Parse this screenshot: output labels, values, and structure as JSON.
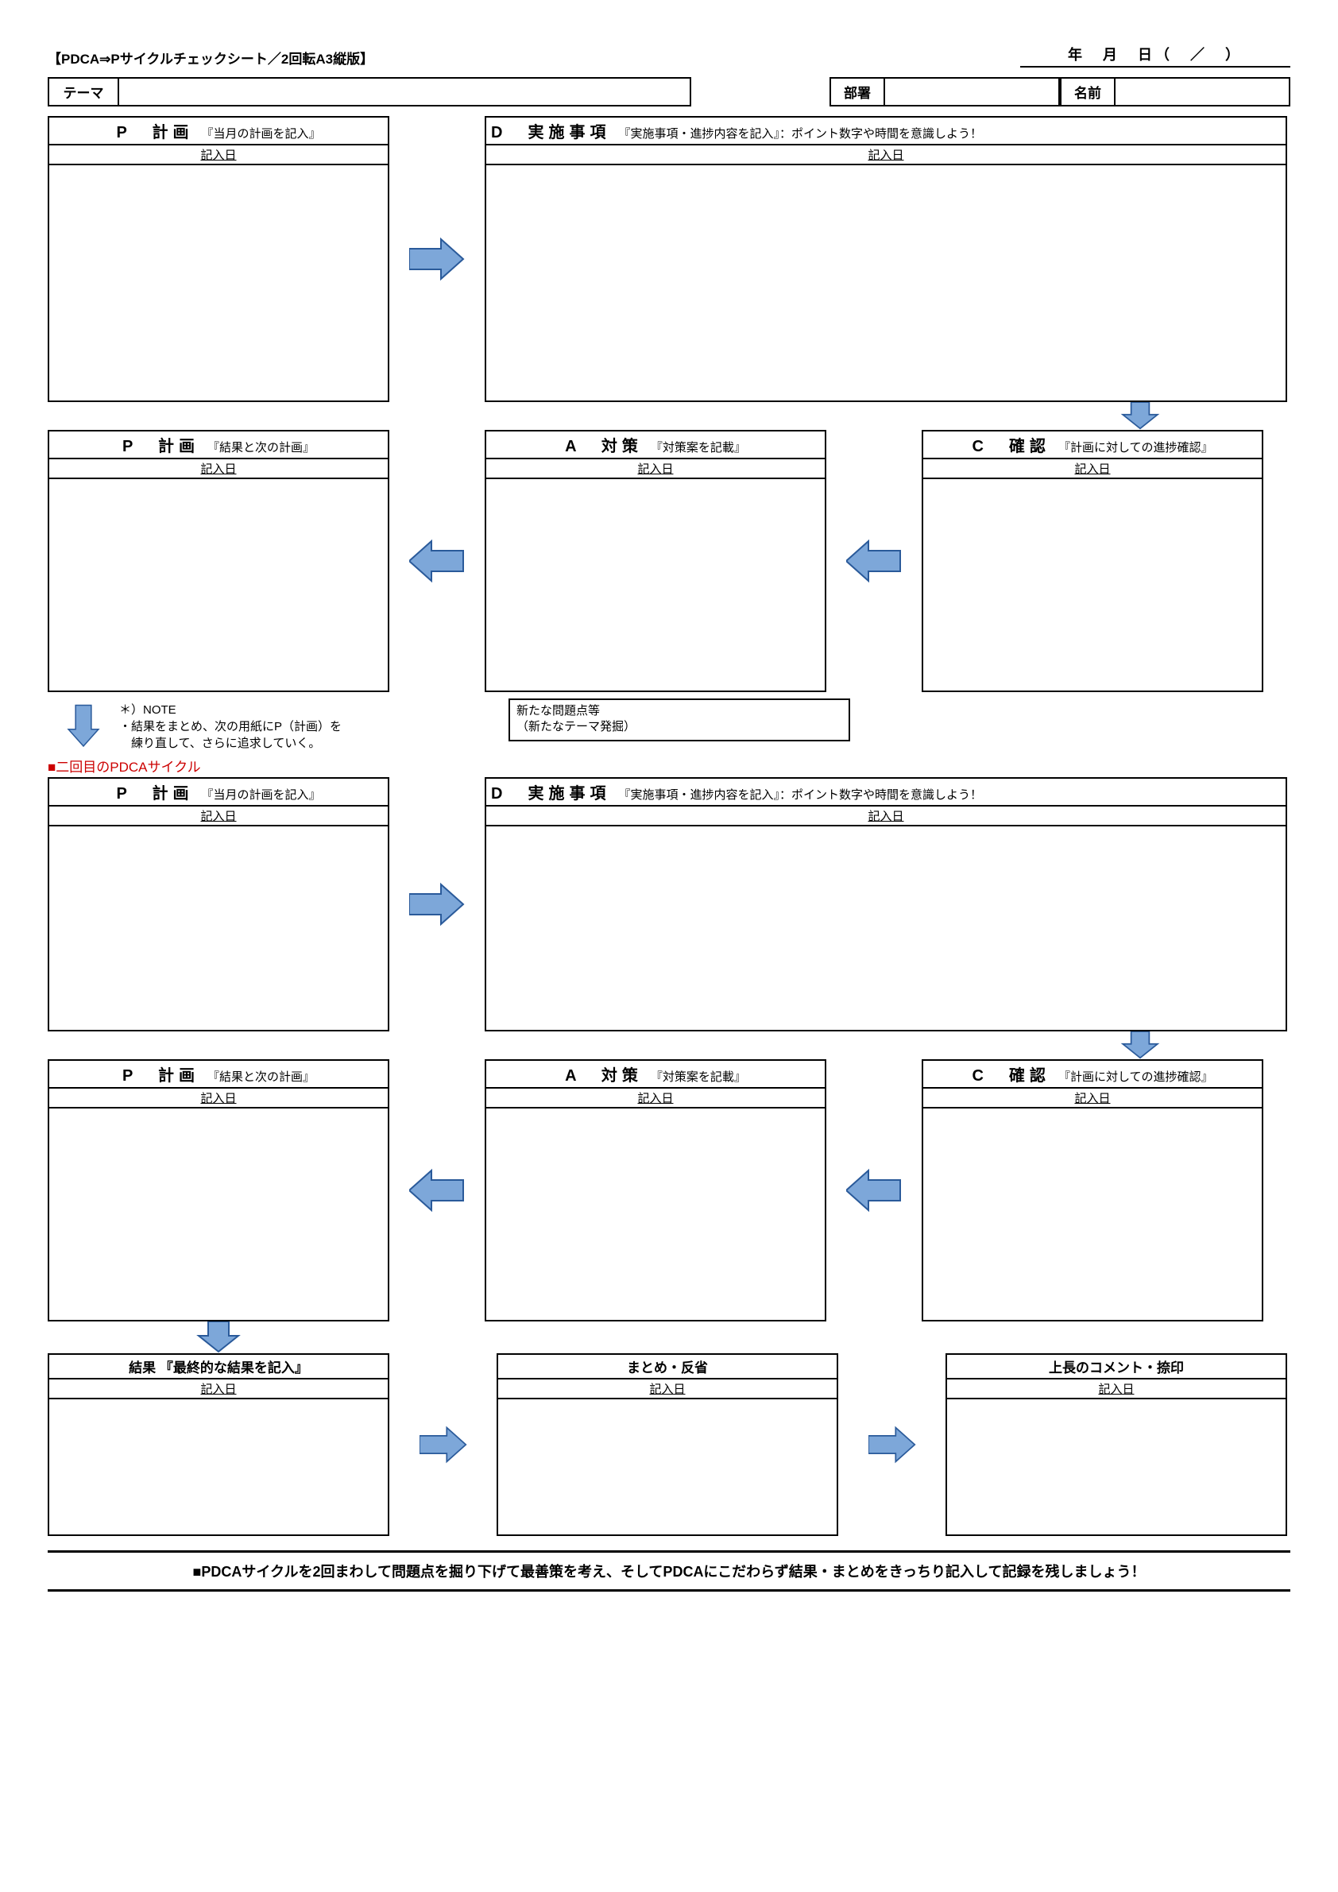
{
  "header": {
    "doc_title": "【PDCA⇒Pサイクルチェックシート／2回転A3縦版】",
    "date_line": "年　月　日（　／　）"
  },
  "meta": {
    "theme_label": "テーマ",
    "dept_label": "部署",
    "name_label": "名前"
  },
  "entry_label": "記入日",
  "cycle1": {
    "p": {
      "code": "P　計画",
      "desc": "『当月の計画を記入』"
    },
    "d": {
      "code": "D　実施事項",
      "desc": "『実施事項・進捗内容を記入』：ポイント数字や時間を意識しよう！"
    },
    "p2": {
      "code": "P　計画",
      "desc": "『結果と次の計画』"
    },
    "a": {
      "code": "A　対策",
      "desc": "『対策案を記載』"
    },
    "c": {
      "code": "C　確認",
      "desc": "『計画に対しての進捗確認』"
    }
  },
  "note": {
    "title": "＊）NOTE",
    "line1": "・結果をまとめ、次の用紙にP（計画）を",
    "line2": "　練り直して、さらに追求していく。"
  },
  "new_issue": {
    "line1": "新たな問題点等",
    "line2": "（新たなテーマ発掘）"
  },
  "red_label": "■二回目のPDCAサイクル",
  "cycle2": {
    "p": {
      "code": "P　計画",
      "desc": "『当月の計画を記入』"
    },
    "d": {
      "code": "D　実施事項",
      "desc": "『実施事項・進捗内容を記入』：ポイント数字や時間を意識しよう！"
    },
    "p2": {
      "code": "P　計画",
      "desc": "『結果と次の計画』"
    },
    "a": {
      "code": "A　対策",
      "desc": "『対策案を記載』"
    },
    "c": {
      "code": "C　確認",
      "desc": "『計画に対しての進捗確認』"
    }
  },
  "final": {
    "result": "結果 『最終的な結果を記入』",
    "summary": "まとめ・反省",
    "boss": "上長のコメント・捺印"
  },
  "bottom_bar": "■PDCAサイクルを2回まわして問題点を掘り下げて最善策を考え、そしてPDCAにこだわらず結果・まとめをきっちり記入して記録を残しましょう！"
}
